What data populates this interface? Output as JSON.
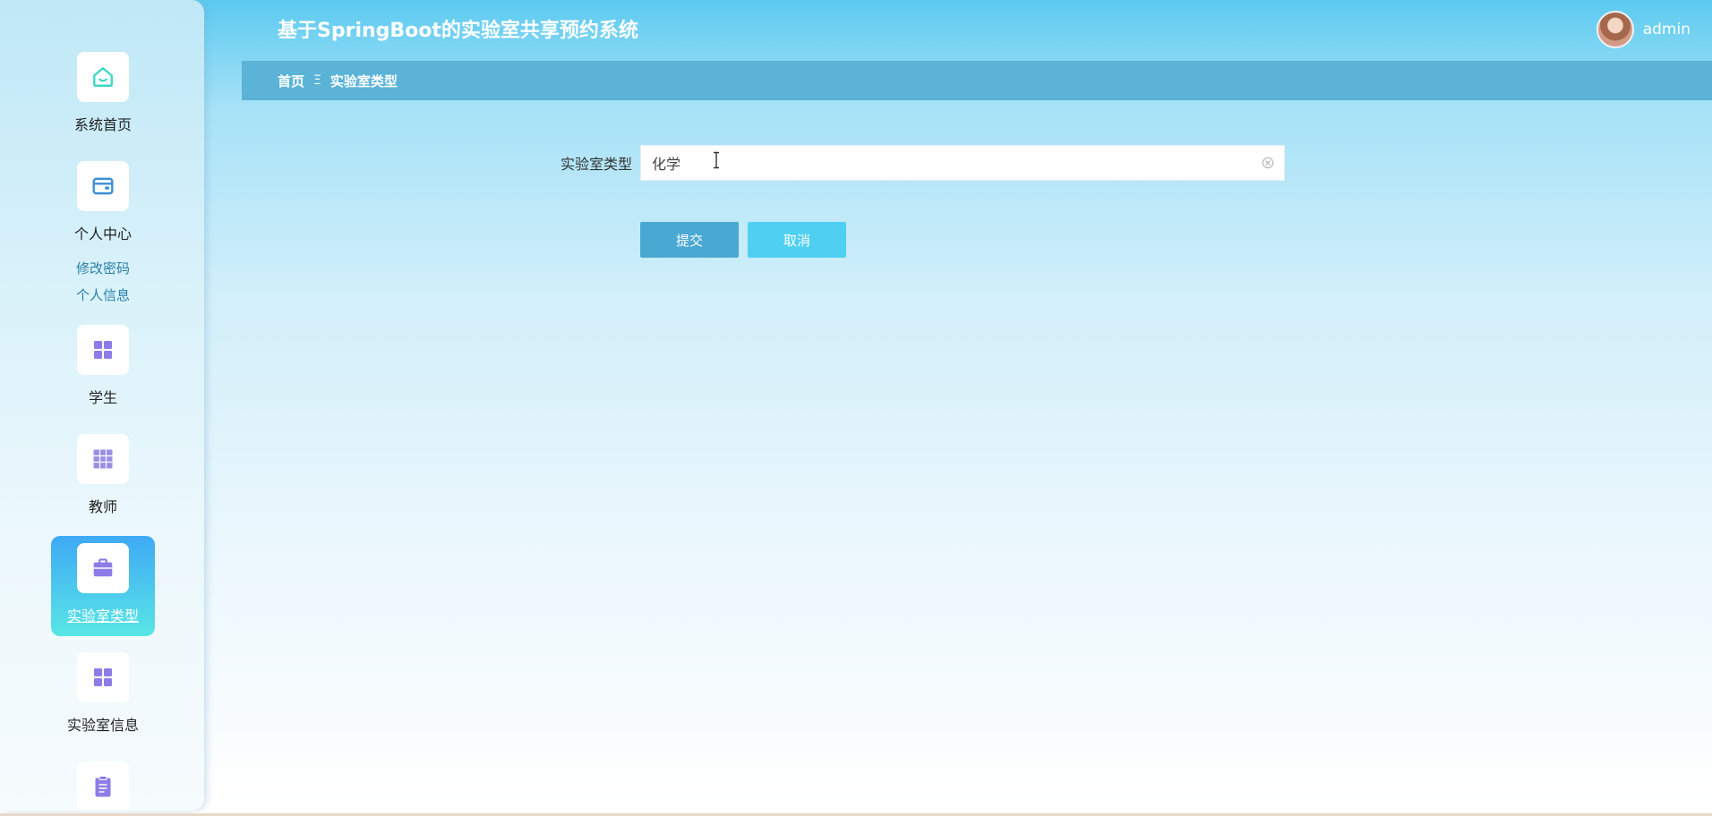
{
  "header": {
    "title": "基于SpringBoot的实验室共享预约系统",
    "username": "admin"
  },
  "sidebar": {
    "items": [
      {
        "label": "系统首页",
        "icon": "home-icon"
      },
      {
        "label": "个人中心",
        "icon": "wallet-card-icon",
        "children": [
          "修改密码",
          "个人信息"
        ]
      },
      {
        "label": "学生",
        "icon": "grid-icon"
      },
      {
        "label": "教师",
        "icon": "table-grid-icon"
      },
      {
        "label": "实验室类型",
        "icon": "briefcase-icon",
        "active": true
      },
      {
        "label": "实验室信息",
        "icon": "grid-icon"
      },
      {
        "label": "",
        "icon": "clipboard-icon"
      }
    ]
  },
  "breadcrumb": {
    "home": "首页",
    "separator": "Ξ",
    "current": "实验室类型"
  },
  "form": {
    "field_label": "实验室类型",
    "field_value": "化学",
    "submit_label": "提交",
    "cancel_label": "取消"
  },
  "colors": {
    "accent": "#5bb3d8",
    "active_menu_start": "#3ea9f5",
    "active_menu_end": "#58e6e6",
    "icon_purple": "#8d7be8",
    "icon_teal": "#3fd6c8",
    "icon_blue": "#3b8fd8",
    "submit": "#4aa9d2",
    "cancel": "#4fd0f3"
  }
}
